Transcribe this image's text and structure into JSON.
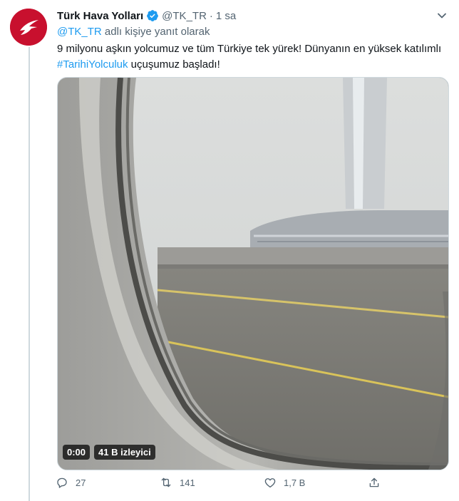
{
  "tweet": {
    "author_name": "Türk Hava Yolları",
    "handle": "@TK_TR",
    "separator": "·",
    "time": "1 sa",
    "reply_mention": "@TK_TR",
    "reply_suffix": " adlı kişiye yanıt olarak",
    "text_part1": "9 milyonu aşkın yolcumuz ve tüm Türkiye tek yürek! Dünyanın en yüksek katılımlı ",
    "hashtag": "#TarihiYolculuk",
    "text_part2": " uçuşumuz başladı!"
  },
  "video": {
    "time": "0:00",
    "views": "41 B izleyici"
  },
  "actions": {
    "reply_count": "27",
    "retweet_count": "141",
    "like_count": "1,7 B"
  },
  "icons": {
    "verified": "verified-badge-icon",
    "caret": "chevron-down-icon",
    "reply": "reply-icon",
    "retweet": "retweet-icon",
    "like": "heart-icon",
    "share": "share-icon"
  },
  "colors": {
    "brand_red": "#c8102e",
    "link_blue": "#1d9bf0",
    "muted_text": "#536471"
  }
}
